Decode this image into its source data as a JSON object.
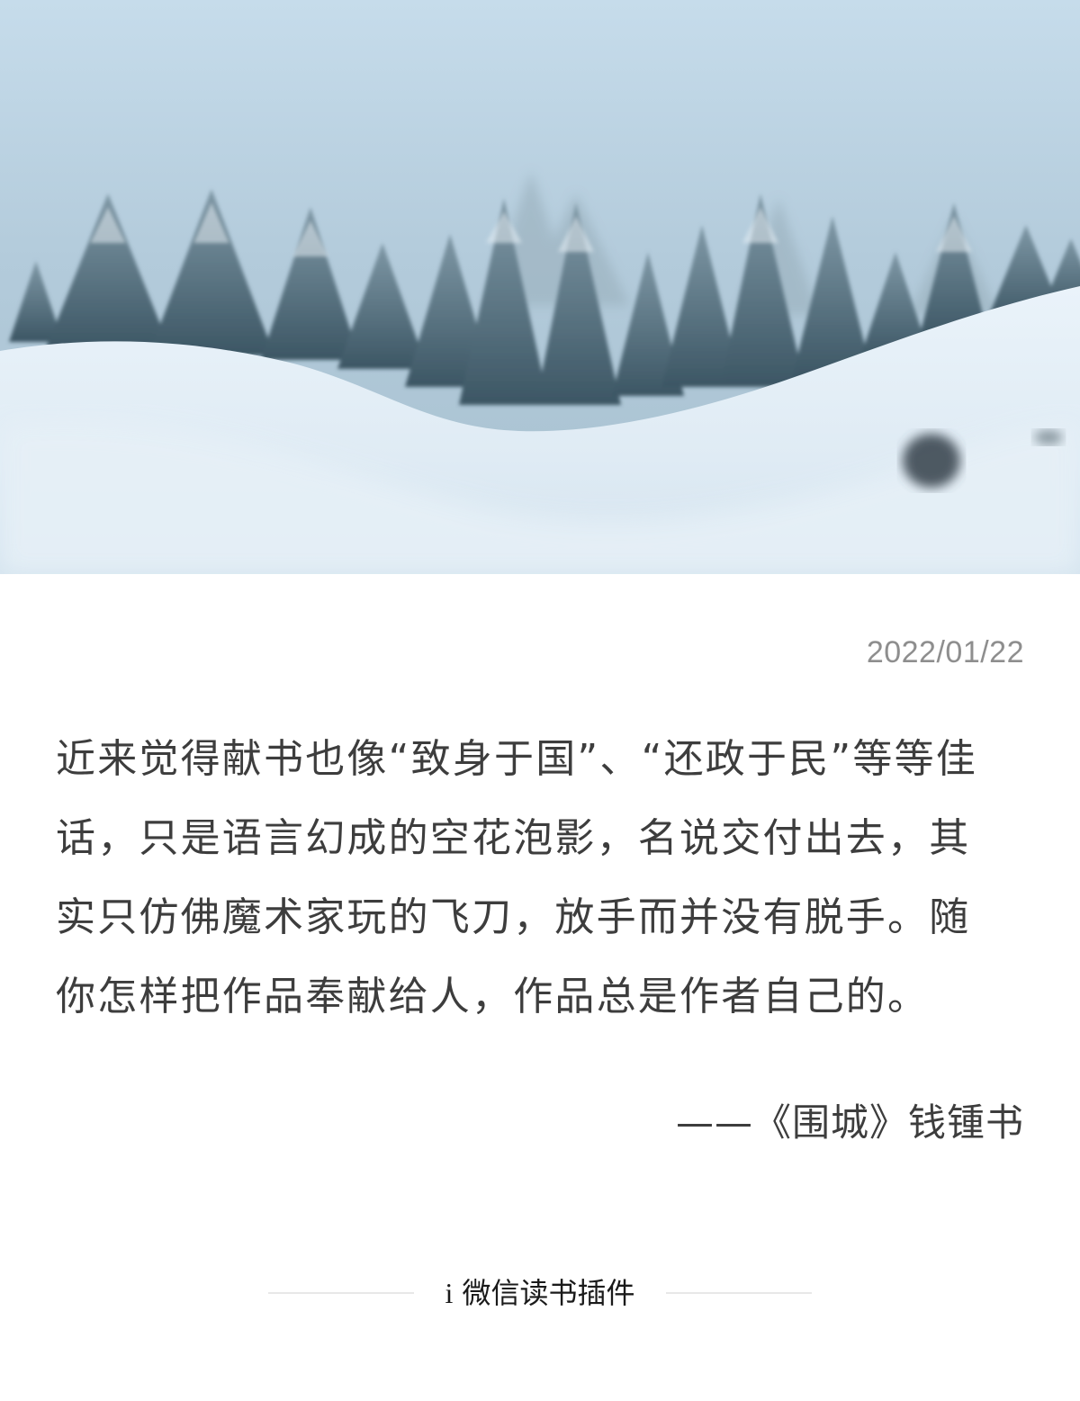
{
  "card": {
    "cover_image": "snowy-forest-landscape",
    "date": "2022/01/22",
    "quote_lines": [
      "近来觉得献书也像“致身于国”、“还政于民”等等佳",
      "话，只是语言幻成的空花泡影，名说交付出去，其",
      "实只仿佛魔术家玩的飞刀，放手而并没有脱手。随",
      "你怎样把作品奉献给人，作品总是作者自己的。"
    ],
    "attribution": "——《围城》钱锺书"
  },
  "footer": {
    "logo_glyph": "i",
    "brand": "微信读书插件"
  },
  "colors": {
    "text": "#3d3d3d",
    "date": "#8e8e8e",
    "divider": "#e8e8e8",
    "sky": "#b8d0e0",
    "snow": "#e9f2f8",
    "trees": "#3d5866"
  }
}
